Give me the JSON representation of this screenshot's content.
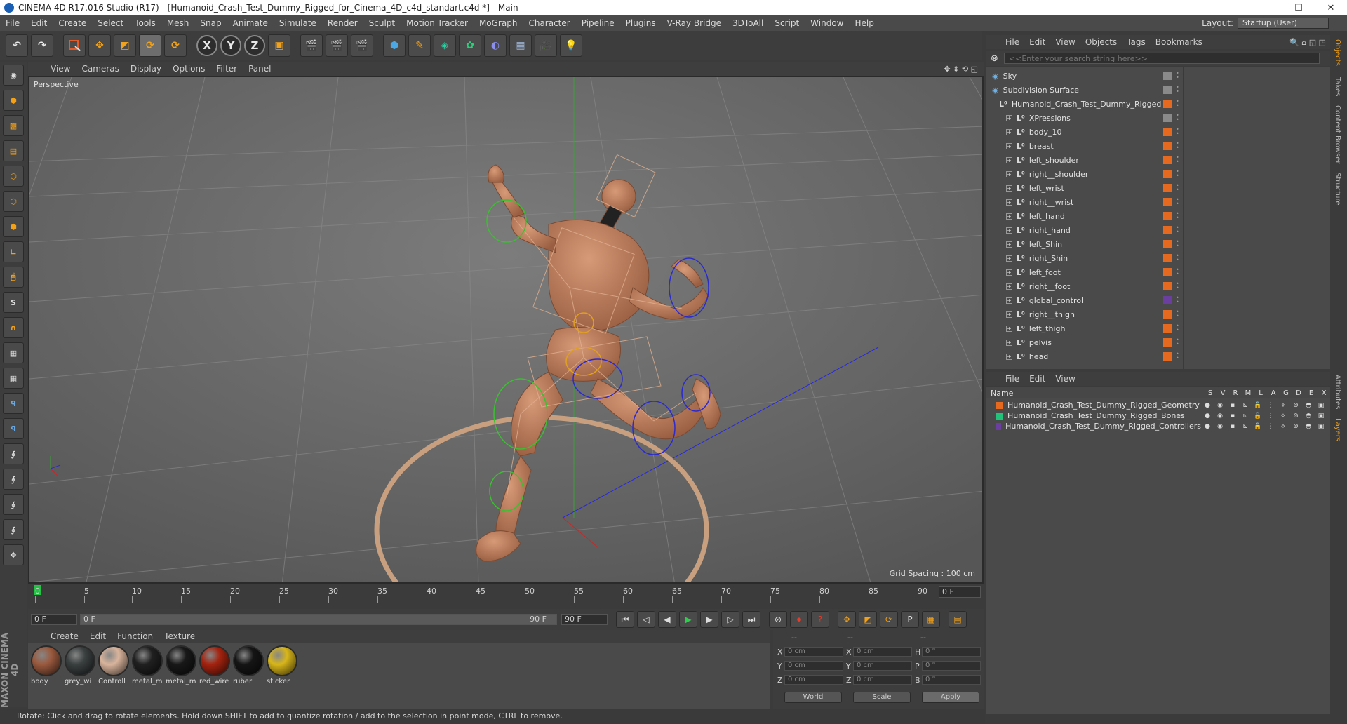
{
  "window": {
    "title": "CINEMA 4D R17.016 Studio (R17) - [Humanoid_Crash_Test_Dummy_Rigged_for_Cinema_4D_c4d_standart.c4d *] - Main",
    "minimize": "–",
    "maximize": "☐",
    "close": "✕"
  },
  "menubar": {
    "items": [
      "File",
      "Edit",
      "Create",
      "Select",
      "Tools",
      "Mesh",
      "Snap",
      "Animate",
      "Simulate",
      "Render",
      "Sculpt",
      "Motion Tracker",
      "MoGraph",
      "Character",
      "Pipeline",
      "Plugins",
      "V-Ray Bridge",
      "3DToAll",
      "Script",
      "Window",
      "Help"
    ],
    "layout_label": "Layout:",
    "layout_value": "Startup (User)"
  },
  "toolbar": {
    "undo": "↶",
    "redo": "↷",
    "axis_x": "X",
    "axis_y": "Y",
    "axis_z": "Z"
  },
  "viewport": {
    "menu": [
      "View",
      "Cameras",
      "Display",
      "Options",
      "Filter",
      "Panel"
    ],
    "label": "Perspective",
    "grid_spacing": "Grid Spacing : 100 cm"
  },
  "timeline": {
    "ticks": [
      "0",
      "5",
      "10",
      "15",
      "20",
      "25",
      "30",
      "35",
      "40",
      "45",
      "50",
      "55",
      "60",
      "65",
      "70",
      "75",
      "80",
      "85",
      "90"
    ],
    "current_frame": "0 F",
    "start_frame": "0 F",
    "range_start": "0 F",
    "range_end": "90 F",
    "end_frame": "90 F"
  },
  "materials": {
    "menu": [
      "Create",
      "Edit",
      "Function",
      "Texture"
    ],
    "items": [
      {
        "name": "body",
        "color": "#9a5a3e"
      },
      {
        "name": "grey_wi",
        "color": "#3a3f3f"
      },
      {
        "name": "Controll",
        "color": "#d9b49c"
      },
      {
        "name": "metal_m",
        "color": "#202020"
      },
      {
        "name": "metal_m",
        "color": "#181818"
      },
      {
        "name": "red_wire",
        "color": "#a5230f"
      },
      {
        "name": "ruber",
        "color": "#151515"
      },
      {
        "name": "sticker",
        "color": "#d8b61a"
      }
    ]
  },
  "coordinates": {
    "header_left": "--",
    "header_mid": "--",
    "header_right": "--",
    "rows": [
      {
        "a": "X",
        "av": "0 cm",
        "b": "X",
        "bv": "0 cm",
        "c": "H",
        "cv": "0 °"
      },
      {
        "a": "Y",
        "av": "0 cm",
        "b": "Y",
        "bv": "0 cm",
        "c": "P",
        "cv": "0 °"
      },
      {
        "a": "Z",
        "av": "0 cm",
        "b": "Z",
        "bv": "0 cm",
        "c": "B",
        "cv": "0 °"
      }
    ],
    "world": "World",
    "scale": "Scale",
    "apply": "Apply"
  },
  "status": "Rotate: Click and drag to rotate elements. Hold down SHIFT to add to quantize rotation / add to the selection in point mode, CTRL to remove.",
  "maxon": "MAXON CINEMA 4D",
  "object_manager": {
    "menu": [
      "File",
      "Edit",
      "View",
      "Objects",
      "Tags",
      "Bookmarks"
    ],
    "search_placeholder": "<<Enter your search string here>>",
    "objects": [
      {
        "name": "Sky",
        "indent": 0
      },
      {
        "name": "Subdivision Surface",
        "indent": 0
      },
      {
        "name": "Humanoid_Crash_Test_Dummy_Rigged",
        "indent": 1
      },
      {
        "name": "XPressions",
        "indent": 2
      },
      {
        "name": "body_10",
        "indent": 2
      },
      {
        "name": "breast",
        "indent": 2
      },
      {
        "name": "left_shoulder",
        "indent": 2
      },
      {
        "name": "right__shoulder",
        "indent": 2
      },
      {
        "name": "left_wrist",
        "indent": 2
      },
      {
        "name": "right__wrist",
        "indent": 2
      },
      {
        "name": "left_hand",
        "indent": 2
      },
      {
        "name": "right_hand",
        "indent": 2
      },
      {
        "name": "left_Shin",
        "indent": 2
      },
      {
        "name": "right_Shin",
        "indent": 2
      },
      {
        "name": "left_foot",
        "indent": 2
      },
      {
        "name": "right__foot",
        "indent": 2
      },
      {
        "name": "global_control",
        "indent": 2
      },
      {
        "name": "right__thigh",
        "indent": 2
      },
      {
        "name": "left_thigh",
        "indent": 2
      },
      {
        "name": "pelvis",
        "indent": 2
      },
      {
        "name": "head",
        "indent": 2
      }
    ]
  },
  "layer_manager": {
    "menu": [
      "File",
      "Edit",
      "View"
    ],
    "name_header": "Name",
    "columns": [
      "S",
      "V",
      "R",
      "M",
      "L",
      "A",
      "G",
      "D",
      "E",
      "X"
    ],
    "layers": [
      {
        "name": "Humanoid_Crash_Test_Dummy_Rigged_Geometry",
        "color": "#e56a1f"
      },
      {
        "name": "Humanoid_Crash_Test_Dummy_Rigged_Bones",
        "color": "#22c27a"
      },
      {
        "name": "Humanoid_Crash_Test_Dummy_Rigged_Controllers",
        "color": "#6a3fa0"
      }
    ]
  },
  "right_tabs": [
    "Objects",
    "Takes",
    "Content Browser",
    "Structure",
    "Attributes",
    "Layers"
  ]
}
